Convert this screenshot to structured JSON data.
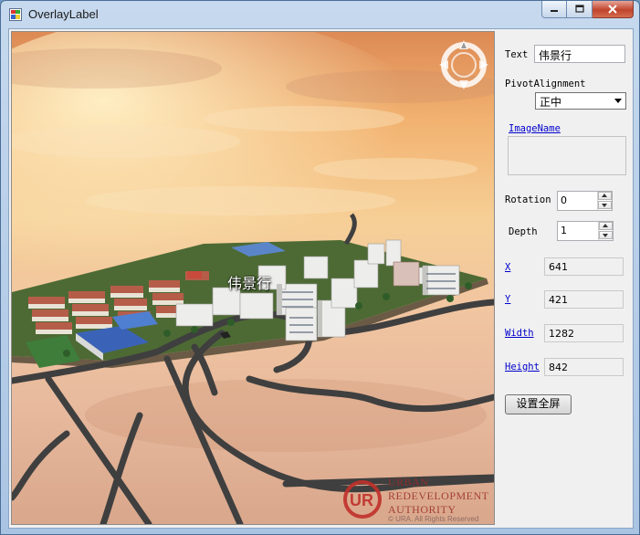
{
  "window": {
    "title": "OverlayLabel"
  },
  "view": {
    "overlay_label": "伟景行",
    "logo": {
      "line1": "URBAN",
      "line2": "REDEVELOPMENT",
      "line3": "AUTHORITY",
      "copyright": "© URA. All Rights Reserved"
    }
  },
  "panel": {
    "text_label": "Text",
    "text_value": "伟景行",
    "pivot_label": "PivotAlignment",
    "pivot_value": "正中",
    "image_name_link": "ImageName",
    "rotation_label": "Rotation",
    "rotation_value": "0",
    "depth_label": "Depth",
    "depth_value": "1",
    "x_link": "X",
    "x_value": "641",
    "y_link": "Y",
    "y_value": "421",
    "width_link": "Width",
    "width_value": "1282",
    "height_link": "Height",
    "height_value": "842",
    "fullscreen_button": "设置全屏"
  },
  "icons": [
    "app-icon",
    "minimize-icon",
    "maximize-icon",
    "close-icon",
    "compass-icon",
    "ura-logo"
  ]
}
